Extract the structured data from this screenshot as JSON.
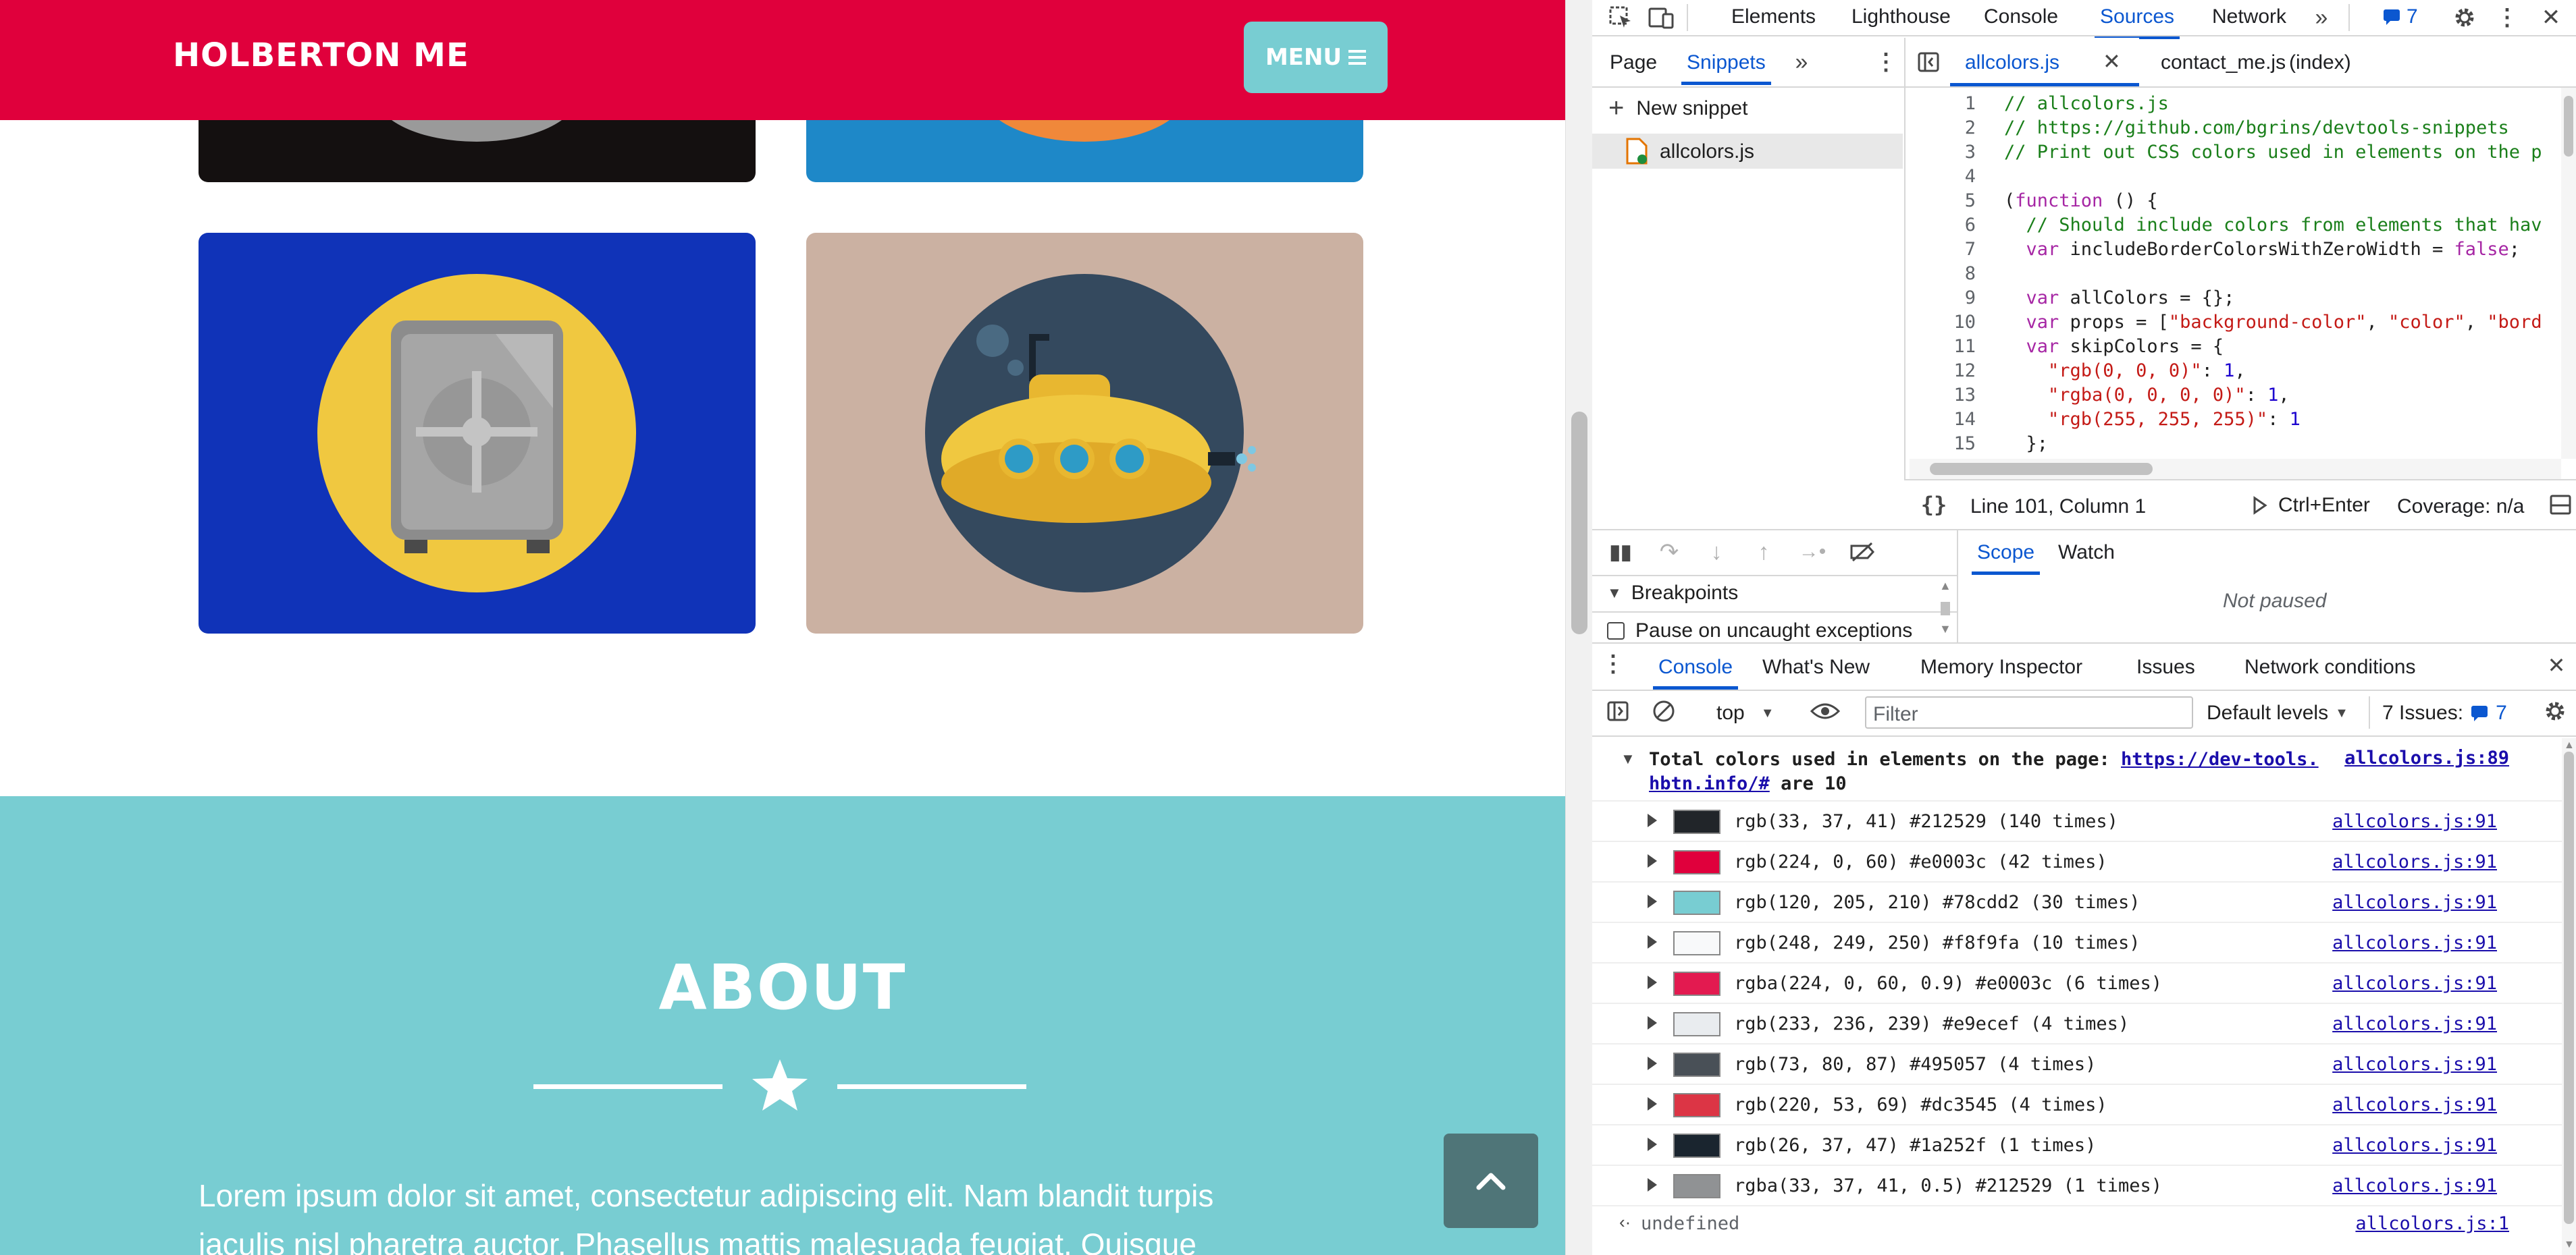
{
  "site": {
    "brand": "HOLBERTON ME",
    "menu_label": "MENU",
    "about_title": "ABOUT",
    "about_line1": "Lorem ipsum dolor sit amet, consectetur adipiscing elit. Nam blandit turpis",
    "about_line2": "iaculis nisl pharetra auctor. Phasellus mattis malesuada feugiat. Quisque",
    "colors": {
      "primary": "#e0003c",
      "teal": "#78cdd2",
      "safe_bg": "#1033b8",
      "sub_bg": "#cbb1a2"
    }
  },
  "devtools": {
    "main_tabs": [
      "Elements",
      "Lighthouse",
      "Console",
      "Sources",
      "Network"
    ],
    "active_main_tab": "Sources",
    "issues_count": "7",
    "nav_tabs": [
      "Page",
      "Snippets"
    ],
    "editor_tabs": [
      "allcolors.js",
      "contact_me.js",
      "(index)"
    ],
    "new_snippet": "New snippet",
    "snippet_file": "allcolors.js",
    "code_lines": [
      "// allcolors.js",
      "// https://github.com/bgrins/devtools-snippets",
      "// Print out CSS colors used in elements on the p",
      "",
      "(function () {",
      "  // Should include colors from elements that hav",
      "  var includeBorderColorsWithZeroWidth = false;",
      "",
      "  var allColors = {};",
      "  var props = [\"background-color\", \"color\", \"bord",
      "  var skipColors = {",
      "    \"rgb(0, 0, 0)\": 1,",
      "    \"rgba(0, 0, 0, 0)\": 1,",
      "    \"rgb(255, 255, 255)\": 1",
      "  };"
    ],
    "status_position": "Line 101, Column 1",
    "run_shortcut": "Ctrl+Enter",
    "coverage": "Coverage: n/a",
    "scope_tab": "Scope",
    "watch_tab": "Watch",
    "breakpoints_label": "Breakpoints",
    "pause_exceptions_label": "Pause on uncaught exceptions",
    "not_paused": "Not paused",
    "drawer_tabs": [
      "Console",
      "What's New",
      "Memory Inspector",
      "Issues",
      "Network conditions"
    ],
    "context": "top",
    "filter_placeholder": "Filter",
    "levels": "Default levels",
    "issues_label": "7 Issues:",
    "issues_badge": "7",
    "summary_text": "Total colors used in elements on the page:",
    "summary_link1": "https://dev-tools.",
    "summary_link2": "hbtn.info/#",
    "summary_tail": "are 10",
    "summary_source": "allcolors.js:89",
    "color_rows": [
      {
        "text": "rgb(33, 37, 41) #212529 (140 times)",
        "swatch": "#212529",
        "source": "allcolors.js:91"
      },
      {
        "text": "rgb(224, 0, 60) #e0003c (42 times)",
        "swatch": "#e0003c",
        "source": "allcolors.js:91"
      },
      {
        "text": "rgb(120, 205, 210) #78cdd2 (30 times)",
        "swatch": "#78cdd2",
        "source": "allcolors.js:91"
      },
      {
        "text": "rgb(248, 249, 250) #f8f9fa (10 times)",
        "swatch": "#f8f9fa",
        "source": "allcolors.js:91"
      },
      {
        "text": "rgba(224, 0, 60, 0.9) #e0003c (6 times)",
        "swatch": "#e31a50",
        "source": "allcolors.js:91"
      },
      {
        "text": "rgb(233, 236, 239) #e9ecef (4 times)",
        "swatch": "#e9ecef",
        "source": "allcolors.js:91"
      },
      {
        "text": "rgb(73, 80, 87) #495057 (4 times)",
        "swatch": "#495057",
        "source": "allcolors.js:91"
      },
      {
        "text": "rgb(220, 53, 69) #dc3545 (4 times)",
        "swatch": "#dc3545",
        "source": "allcolors.js:91"
      },
      {
        "text": "rgb(26, 37, 47) #1a252f (1 times)",
        "swatch": "#1a252f",
        "source": "allcolors.js:91"
      },
      {
        "text": "rgba(33, 37, 41, 0.5) #212529 (1 times)",
        "swatch": "#909294",
        "source": "allcolors.js:91"
      }
    ],
    "result_text": "undefined",
    "result_source": "allcolors.js:1"
  }
}
